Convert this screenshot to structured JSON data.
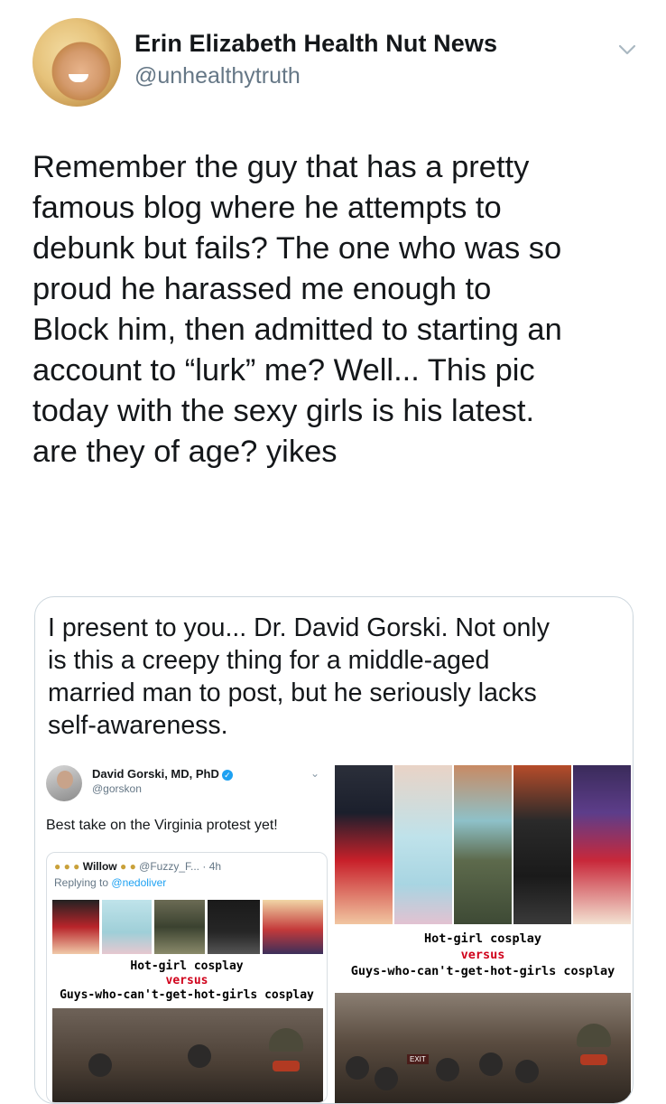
{
  "tweet": {
    "author_name": "Erin Elizabeth Health Nut News",
    "author_handle": "@unhealthytruth",
    "body_lines": [
      "Remember the guy that has a pretty",
      "famous blog where he  attempts to",
      "debunk but fails? The one who was so",
      "proud he harassed me enough to",
      "Block him, then admitted to starting an",
      "account to “lurk” me? Well... This pic",
      "today with the sexy girls is his latest.",
      "are they of age? yikes"
    ]
  },
  "quoted": {
    "text_lines": [
      "I present to you... Dr. David Gorski. Not only",
      "is this a creepy thing for a middle-aged",
      "married man to post, but he seriously lacks",
      "self-awareness."
    ],
    "embedded_tweet": {
      "author_name": "David Gorski, MD, PhD",
      "verified_glyph": "✓",
      "author_handle": "@gorskon",
      "text": "Best take on the Virginia protest yet!",
      "reply": {
        "author_name": "Willow",
        "author_handle": "@Fuzzy_F...",
        "time": "· 4h",
        "replying_to_prefix": "Replying to",
        "replying_to": "@nedoliver",
        "caption_line1": "Hot-girl cosplay",
        "caption_line2": "versus",
        "caption_line3": "Guys-who-can't-get-hot-girls cosplay"
      }
    },
    "image": {
      "caption_line1": "Hot-girl cosplay",
      "caption_line2": "versus",
      "caption_line3": "Guys-who-can't-get-hot-girls cosplay",
      "exit_sign": "EXIT"
    }
  },
  "icons": {
    "caret": "chevron-down-icon",
    "verified": "verified-badge-icon"
  },
  "colors": {
    "text": "#14171a",
    "secondary": "#657786",
    "border": "#ccd6dd",
    "accent_red": "#d0021b",
    "link": "#1da1f2"
  }
}
